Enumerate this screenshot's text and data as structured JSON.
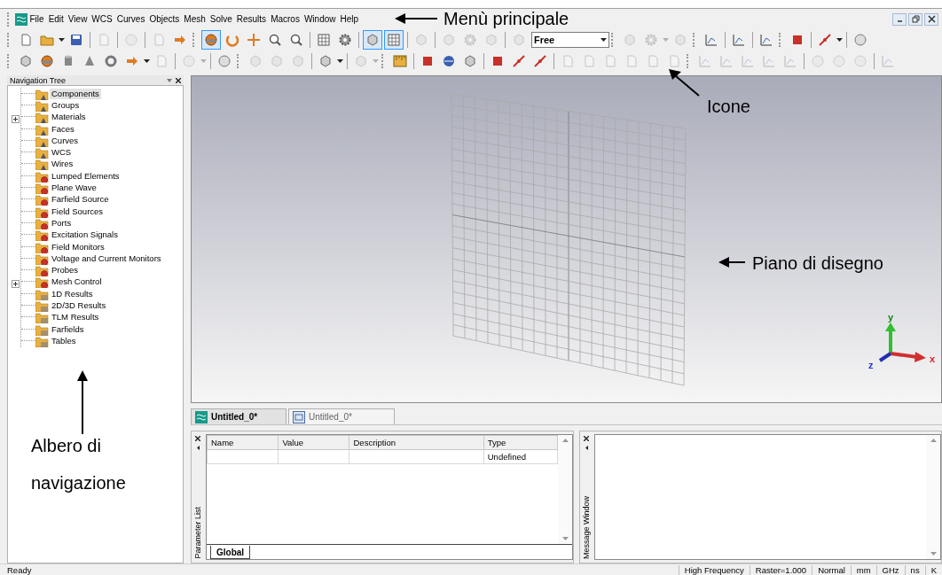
{
  "menu": {
    "items": [
      "File",
      "Edit",
      "View",
      "WCS",
      "Curves",
      "Objects",
      "Mesh",
      "Solve",
      "Results",
      "Macros",
      "Window",
      "Help"
    ]
  },
  "toolbars": [
    {
      "items": [
        {
          "kind": "grip"
        },
        {
          "kind": "button",
          "disabled": false,
          "selected": false
        },
        {
          "kind": "button",
          "disabled": false,
          "selected": false
        },
        {
          "kind": "caret",
          "disabled": false
        },
        {
          "kind": "button",
          "disabled": false,
          "selected": false
        },
        {
          "kind": "separator"
        },
        {
          "kind": "button",
          "disabled": true,
          "selected": false
        },
        {
          "kind": "separator"
        },
        {
          "kind": "button",
          "disabled": true,
          "selected": false
        },
        {
          "kind": "separator"
        },
        {
          "kind": "button",
          "disabled": true,
          "selected": false
        },
        {
          "kind": "button",
          "disabled": false,
          "selected": false
        },
        {
          "kind": "grip"
        },
        {
          "kind": "button",
          "disabled": false,
          "selected": true
        },
        {
          "kind": "button",
          "disabled": false,
          "selected": false
        },
        {
          "kind": "button",
          "disabled": false,
          "selected": false
        },
        {
          "kind": "button",
          "disabled": false,
          "selected": false
        },
        {
          "kind": "button",
          "disabled": false,
          "selected": false
        },
        {
          "kind": "separator"
        },
        {
          "kind": "button",
          "disabled": false,
          "selected": false
        },
        {
          "kind": "button",
          "disabled": false,
          "selected": false
        },
        {
          "kind": "separator"
        },
        {
          "kind": "button",
          "disabled": false,
          "selected": true
        },
        {
          "kind": "button",
          "disabled": false,
          "selected": true
        },
        {
          "kind": "separator"
        },
        {
          "kind": "button",
          "disabled": true,
          "selected": false
        },
        {
          "kind": "separator"
        },
        {
          "kind": "button",
          "disabled": true,
          "selected": false
        },
        {
          "kind": "button",
          "disabled": true,
          "selected": false
        },
        {
          "kind": "button",
          "disabled": true,
          "selected": false
        },
        {
          "kind": "separator"
        },
        {
          "kind": "button",
          "disabled": true,
          "selected": false
        },
        {
          "kind": "combo",
          "value": "Free"
        },
        {
          "kind": "grip"
        },
        {
          "kind": "button",
          "disabled": true,
          "selected": false
        },
        {
          "kind": "button",
          "disabled": true,
          "selected": false
        },
        {
          "kind": "caret",
          "disabled": true
        },
        {
          "kind": "button",
          "disabled": true,
          "selected": false
        },
        {
          "kind": "grip"
        },
        {
          "kind": "button",
          "disabled": false,
          "selected": false
        },
        {
          "kind": "separator"
        },
        {
          "kind": "button",
          "disabled": false,
          "selected": false
        },
        {
          "kind": "separator"
        },
        {
          "kind": "button",
          "disabled": false,
          "selected": false
        },
        {
          "kind": "grip"
        },
        {
          "kind": "button",
          "disabled": false,
          "selected": false
        },
        {
          "kind": "separator"
        },
        {
          "kind": "button",
          "disabled": false,
          "selected": false
        },
        {
          "kind": "caret",
          "disabled": false
        },
        {
          "kind": "separator"
        },
        {
          "kind": "button",
          "disabled": false,
          "selected": false
        }
      ]
    },
    {
      "items": [
        {
          "kind": "grip"
        },
        {
          "kind": "button",
          "disabled": false,
          "selected": false
        },
        {
          "kind": "button",
          "disabled": false,
          "selected": false
        },
        {
          "kind": "button",
          "disabled": false,
          "selected": false
        },
        {
          "kind": "button",
          "disabled": false,
          "selected": false
        },
        {
          "kind": "button",
          "disabled": false,
          "selected": false
        },
        {
          "kind": "button",
          "disabled": false,
          "selected": false
        },
        {
          "kind": "caret",
          "disabled": false
        },
        {
          "kind": "button",
          "disabled": true,
          "selected": false
        },
        {
          "kind": "separator"
        },
        {
          "kind": "button",
          "disabled": true,
          "selected": false
        },
        {
          "kind": "caret",
          "disabled": true
        },
        {
          "kind": "separator"
        },
        {
          "kind": "button",
          "disabled": false,
          "selected": false
        },
        {
          "kind": "grip"
        },
        {
          "kind": "button",
          "disabled": true,
          "selected": false
        },
        {
          "kind": "button",
          "disabled": true,
          "selected": false
        },
        {
          "kind": "button",
          "disabled": true,
          "selected": false
        },
        {
          "kind": "separator"
        },
        {
          "kind": "button",
          "disabled": false,
          "selected": false
        },
        {
          "kind": "caret",
          "disabled": false
        },
        {
          "kind": "separator"
        },
        {
          "kind": "button",
          "disabled": true,
          "selected": false
        },
        {
          "kind": "caret",
          "disabled": true
        },
        {
          "kind": "grip"
        },
        {
          "kind": "button",
          "disabled": false,
          "selected": false
        },
        {
          "kind": "separator"
        },
        {
          "kind": "button",
          "disabled": false,
          "selected": false
        },
        {
          "kind": "button",
          "disabled": false,
          "selected": false
        },
        {
          "kind": "button",
          "disabled": false,
          "selected": false
        },
        {
          "kind": "separator"
        },
        {
          "kind": "button",
          "disabled": false,
          "selected": false
        },
        {
          "kind": "button",
          "disabled": false,
          "selected": false
        },
        {
          "kind": "button",
          "disabled": false,
          "selected": false
        },
        {
          "kind": "separator"
        },
        {
          "kind": "button",
          "disabled": true,
          "selected": false
        },
        {
          "kind": "button",
          "disabled": true,
          "selected": false
        },
        {
          "kind": "button",
          "disabled": true,
          "selected": false
        },
        {
          "kind": "button",
          "disabled": true,
          "selected": false
        },
        {
          "kind": "button",
          "disabled": true,
          "selected": false
        },
        {
          "kind": "button",
          "disabled": true,
          "selected": false
        },
        {
          "kind": "grip"
        },
        {
          "kind": "button",
          "disabled": true,
          "selected": false
        },
        {
          "kind": "button",
          "disabled": true,
          "selected": false
        },
        {
          "kind": "button",
          "disabled": true,
          "selected": false
        },
        {
          "kind": "button",
          "disabled": true,
          "selected": false
        },
        {
          "kind": "button",
          "disabled": true,
          "selected": false
        },
        {
          "kind": "separator"
        },
        {
          "kind": "button",
          "disabled": true,
          "selected": false
        },
        {
          "kind": "button",
          "disabled": true,
          "selected": false
        },
        {
          "kind": "button",
          "disabled": true,
          "selected": false
        },
        {
          "kind": "separator"
        },
        {
          "kind": "button",
          "disabled": true,
          "selected": false
        }
      ]
    }
  ],
  "navigation_tree": {
    "title": "Navigation Tree",
    "items": [
      {
        "label": "Components",
        "kind": "component",
        "selected": true,
        "collapsed": false
      },
      {
        "label": "Groups",
        "kind": "component",
        "selected": false,
        "collapsed": false
      },
      {
        "label": "Materials",
        "kind": "component",
        "selected": false,
        "collapsed": true
      },
      {
        "label": "Faces",
        "kind": "component",
        "selected": false,
        "collapsed": false
      },
      {
        "label": "Curves",
        "kind": "component",
        "selected": false,
        "collapsed": false
      },
      {
        "label": "WCS",
        "kind": "component",
        "selected": false,
        "collapsed": false
      },
      {
        "label": "Wires",
        "kind": "component",
        "selected": false,
        "collapsed": false
      },
      {
        "label": "Lumped Elements",
        "kind": "source",
        "selected": false,
        "collapsed": false
      },
      {
        "label": "Plane Wave",
        "kind": "source",
        "selected": false,
        "collapsed": false
      },
      {
        "label": "Farfield Source",
        "kind": "source",
        "selected": false,
        "collapsed": false
      },
      {
        "label": "Field Sources",
        "kind": "source",
        "selected": false,
        "collapsed": false
      },
      {
        "label": "Ports",
        "kind": "source",
        "selected": false,
        "collapsed": false
      },
      {
        "label": "Excitation Signals",
        "kind": "source",
        "selected": false,
        "collapsed": false
      },
      {
        "label": "Field Monitors",
        "kind": "source",
        "selected": false,
        "collapsed": false
      },
      {
        "label": "Voltage and Current Monitors",
        "kind": "source",
        "selected": false,
        "collapsed": false
      },
      {
        "label": "Probes",
        "kind": "source",
        "selected": false,
        "collapsed": false
      },
      {
        "label": "Mesh Control",
        "kind": "source",
        "selected": false,
        "collapsed": true
      },
      {
        "label": "1D Results",
        "kind": "result",
        "selected": false,
        "collapsed": false
      },
      {
        "label": "2D/3D Results",
        "kind": "result",
        "selected": false,
        "collapsed": false
      },
      {
        "label": "TLM Results",
        "kind": "result",
        "selected": false,
        "collapsed": false
      },
      {
        "label": "Farfields",
        "kind": "result",
        "selected": false,
        "collapsed": false
      },
      {
        "label": "Tables",
        "kind": "result",
        "selected": false,
        "collapsed": false
      }
    ]
  },
  "viewport": {
    "axis_labels": {
      "x": "x",
      "y": "y",
      "z": "z"
    }
  },
  "document_tabs": [
    {
      "label": "Untitled_0*",
      "selected": true
    },
    {
      "label": "Untitled_0*",
      "selected": false
    }
  ],
  "parameter_list": {
    "title": "Parameter List",
    "columns": [
      "Name",
      "Value",
      "Description",
      "Type"
    ],
    "rows": [
      [
        "",
        "",
        "",
        "Undefined"
      ]
    ],
    "tabs": [
      {
        "label": "Global",
        "selected": true
      }
    ]
  },
  "message_window": {
    "title": "Message Window"
  },
  "status_bar": {
    "message": "Ready",
    "fields": [
      "High Frequency",
      "Raster=1.000",
      "Normal",
      "mm",
      "GHz",
      "ns",
      "K"
    ]
  },
  "annotations": [
    {
      "text": "Menù principale"
    },
    {
      "text": "Icone"
    },
    {
      "text": "Piano di disegno"
    },
    {
      "text": "Albero di navigazione"
    }
  ]
}
